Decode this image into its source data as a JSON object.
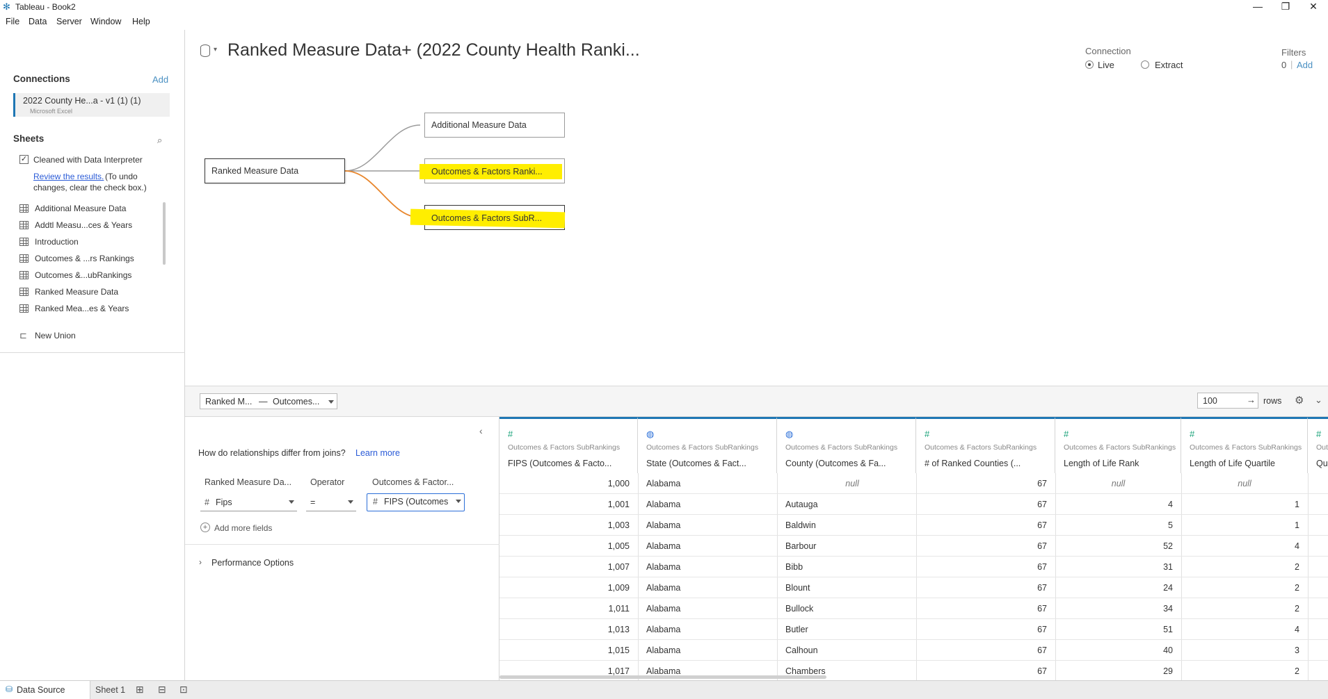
{
  "window": {
    "title": "Tableau - Book2"
  },
  "menu": [
    "File",
    "Data",
    "Server",
    "Window",
    "Help"
  ],
  "connections": {
    "heading": "Connections",
    "add_label": "Add",
    "items": [
      {
        "name": "2022 County He...a - v1 (1) (1)",
        "type": "Microsoft Excel"
      }
    ]
  },
  "sheets": {
    "heading": "Sheets",
    "interpreter_label": "Cleaned with Data Interpreter",
    "interpreter_checked": true,
    "review_link": "Review the results.",
    "review_note_1": "(To undo",
    "review_note_2": "changes, clear the check box.)",
    "items": [
      "Additional Measure Data",
      "Addtl Measu...ces & Years",
      "Introduction",
      "Outcomes & ...rs Rankings",
      "Outcomes &...ubRankings",
      "Ranked Measure Data",
      "Ranked Mea...es & Years"
    ],
    "new_union": "New Union"
  },
  "canvas": {
    "title": "Ranked Measure Data+ (2022 County Health Ranki...",
    "primary_table": "Ranked Measure Data",
    "related_tables": [
      "Additional Measure Data",
      "Outcomes & Factors Ranki...",
      "Outcomes & Factors SubR..."
    ]
  },
  "connection_mode": {
    "label": "Connection",
    "options": [
      "Live",
      "Extract"
    ],
    "selected": "Live"
  },
  "filters": {
    "label": "Filters",
    "count": "0",
    "add_label": "Add"
  },
  "table_selector": {
    "left": "Ranked M...",
    "separator": "—",
    "right": "Outcomes..."
  },
  "rows": {
    "value": "100",
    "label": "rows"
  },
  "relationship": {
    "question": "How do relationships differ from joins?",
    "learn_more": "Learn more",
    "left_header": "Ranked Measure Da...",
    "operator_header": "Operator",
    "right_header": "Outcomes & Factor...",
    "left_field": "Fips",
    "operator": "=",
    "right_field": "FIPS (Outcomes",
    "add_more": "Add more fields",
    "performance": "Performance Options"
  },
  "grid": {
    "columns": [
      {
        "icon": "#",
        "table": "Outcomes & Factors SubRankings",
        "field": "FIPS (Outcomes & Facto..."
      },
      {
        "icon": "globe",
        "table": "Outcomes & Factors SubRankings",
        "field": "State (Outcomes & Fact..."
      },
      {
        "icon": "globe",
        "table": "Outcomes & Factors SubRankings",
        "field": "County (Outcomes & Fa..."
      },
      {
        "icon": "#",
        "table": "Outcomes & Factors SubRankings",
        "field": "# of Ranked Counties (..."
      },
      {
        "icon": "#",
        "table": "Outcomes & Factors SubRankings",
        "field": "Length of Life Rank"
      },
      {
        "icon": "#",
        "table": "Outcomes & Factors SubRankings",
        "field": "Length of Life Quartile"
      },
      {
        "icon": "#",
        "table": "Out",
        "field": "Qu"
      }
    ],
    "rows": [
      [
        "1,000",
        "Alabama",
        "null",
        "67",
        "null",
        "null"
      ],
      [
        "1,001",
        "Alabama",
        "Autauga",
        "67",
        "4",
        "1"
      ],
      [
        "1,003",
        "Alabama",
        "Baldwin",
        "67",
        "5",
        "1"
      ],
      [
        "1,005",
        "Alabama",
        "Barbour",
        "67",
        "52",
        "4"
      ],
      [
        "1,007",
        "Alabama",
        "Bibb",
        "67",
        "31",
        "2"
      ],
      [
        "1,009",
        "Alabama",
        "Blount",
        "67",
        "24",
        "2"
      ],
      [
        "1,011",
        "Alabama",
        "Bullock",
        "67",
        "34",
        "2"
      ],
      [
        "1,013",
        "Alabama",
        "Butler",
        "67",
        "51",
        "4"
      ],
      [
        "1,015",
        "Alabama",
        "Calhoun",
        "67",
        "40",
        "3"
      ],
      [
        "1,017",
        "Alabama",
        "Chambers",
        "67",
        "29",
        "2"
      ]
    ]
  },
  "tabs": {
    "data_source": "Data Source",
    "sheet1": "Sheet 1"
  },
  "colors": {
    "accent": "#1f77b4",
    "highlight": "#ffee00",
    "relation_line": "#e8862c"
  }
}
